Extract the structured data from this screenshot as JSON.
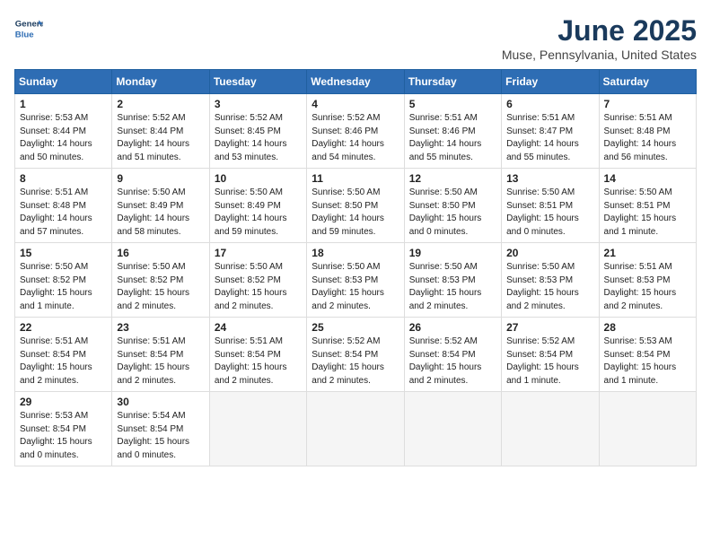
{
  "header": {
    "logo_line1": "General",
    "logo_line2": "Blue",
    "month": "June 2025",
    "location": "Muse, Pennsylvania, United States"
  },
  "weekdays": [
    "Sunday",
    "Monday",
    "Tuesday",
    "Wednesday",
    "Thursday",
    "Friday",
    "Saturday"
  ],
  "weeks": [
    [
      {
        "day": "1",
        "sunrise": "5:53 AM",
        "sunset": "8:44 PM",
        "daylight": "14 hours and 50 minutes."
      },
      {
        "day": "2",
        "sunrise": "5:52 AM",
        "sunset": "8:44 PM",
        "daylight": "14 hours and 51 minutes."
      },
      {
        "day": "3",
        "sunrise": "5:52 AM",
        "sunset": "8:45 PM",
        "daylight": "14 hours and 53 minutes."
      },
      {
        "day": "4",
        "sunrise": "5:52 AM",
        "sunset": "8:46 PM",
        "daylight": "14 hours and 54 minutes."
      },
      {
        "day": "5",
        "sunrise": "5:51 AM",
        "sunset": "8:46 PM",
        "daylight": "14 hours and 55 minutes."
      },
      {
        "day": "6",
        "sunrise": "5:51 AM",
        "sunset": "8:47 PM",
        "daylight": "14 hours and 55 minutes."
      },
      {
        "day": "7",
        "sunrise": "5:51 AM",
        "sunset": "8:48 PM",
        "daylight": "14 hours and 56 minutes."
      }
    ],
    [
      {
        "day": "8",
        "sunrise": "5:51 AM",
        "sunset": "8:48 PM",
        "daylight": "14 hours and 57 minutes."
      },
      {
        "day": "9",
        "sunrise": "5:50 AM",
        "sunset": "8:49 PM",
        "daylight": "14 hours and 58 minutes."
      },
      {
        "day": "10",
        "sunrise": "5:50 AM",
        "sunset": "8:49 PM",
        "daylight": "14 hours and 59 minutes."
      },
      {
        "day": "11",
        "sunrise": "5:50 AM",
        "sunset": "8:50 PM",
        "daylight": "14 hours and 59 minutes."
      },
      {
        "day": "12",
        "sunrise": "5:50 AM",
        "sunset": "8:50 PM",
        "daylight": "15 hours and 0 minutes."
      },
      {
        "day": "13",
        "sunrise": "5:50 AM",
        "sunset": "8:51 PM",
        "daylight": "15 hours and 0 minutes."
      },
      {
        "day": "14",
        "sunrise": "5:50 AM",
        "sunset": "8:51 PM",
        "daylight": "15 hours and 1 minute."
      }
    ],
    [
      {
        "day": "15",
        "sunrise": "5:50 AM",
        "sunset": "8:52 PM",
        "daylight": "15 hours and 1 minute."
      },
      {
        "day": "16",
        "sunrise": "5:50 AM",
        "sunset": "8:52 PM",
        "daylight": "15 hours and 2 minutes."
      },
      {
        "day": "17",
        "sunrise": "5:50 AM",
        "sunset": "8:52 PM",
        "daylight": "15 hours and 2 minutes."
      },
      {
        "day": "18",
        "sunrise": "5:50 AM",
        "sunset": "8:53 PM",
        "daylight": "15 hours and 2 minutes."
      },
      {
        "day": "19",
        "sunrise": "5:50 AM",
        "sunset": "8:53 PM",
        "daylight": "15 hours and 2 minutes."
      },
      {
        "day": "20",
        "sunrise": "5:50 AM",
        "sunset": "8:53 PM",
        "daylight": "15 hours and 2 minutes."
      },
      {
        "day": "21",
        "sunrise": "5:51 AM",
        "sunset": "8:53 PM",
        "daylight": "15 hours and 2 minutes."
      }
    ],
    [
      {
        "day": "22",
        "sunrise": "5:51 AM",
        "sunset": "8:54 PM",
        "daylight": "15 hours and 2 minutes."
      },
      {
        "day": "23",
        "sunrise": "5:51 AM",
        "sunset": "8:54 PM",
        "daylight": "15 hours and 2 minutes."
      },
      {
        "day": "24",
        "sunrise": "5:51 AM",
        "sunset": "8:54 PM",
        "daylight": "15 hours and 2 minutes."
      },
      {
        "day": "25",
        "sunrise": "5:52 AM",
        "sunset": "8:54 PM",
        "daylight": "15 hours and 2 minutes."
      },
      {
        "day": "26",
        "sunrise": "5:52 AM",
        "sunset": "8:54 PM",
        "daylight": "15 hours and 2 minutes."
      },
      {
        "day": "27",
        "sunrise": "5:52 AM",
        "sunset": "8:54 PM",
        "daylight": "15 hours and 1 minute."
      },
      {
        "day": "28",
        "sunrise": "5:53 AM",
        "sunset": "8:54 PM",
        "daylight": "15 hours and 1 minute."
      }
    ],
    [
      {
        "day": "29",
        "sunrise": "5:53 AM",
        "sunset": "8:54 PM",
        "daylight": "15 hours and 0 minutes."
      },
      {
        "day": "30",
        "sunrise": "5:54 AM",
        "sunset": "8:54 PM",
        "daylight": "15 hours and 0 minutes."
      },
      null,
      null,
      null,
      null,
      null
    ]
  ]
}
